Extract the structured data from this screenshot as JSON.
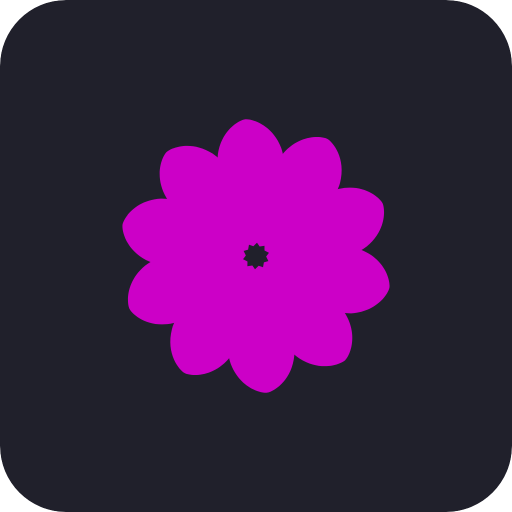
{
  "icon": {
    "name": "flower-app-icon",
    "background_color": "#20202b",
    "petal_color": "#cc00c7",
    "petal_count": 10
  }
}
